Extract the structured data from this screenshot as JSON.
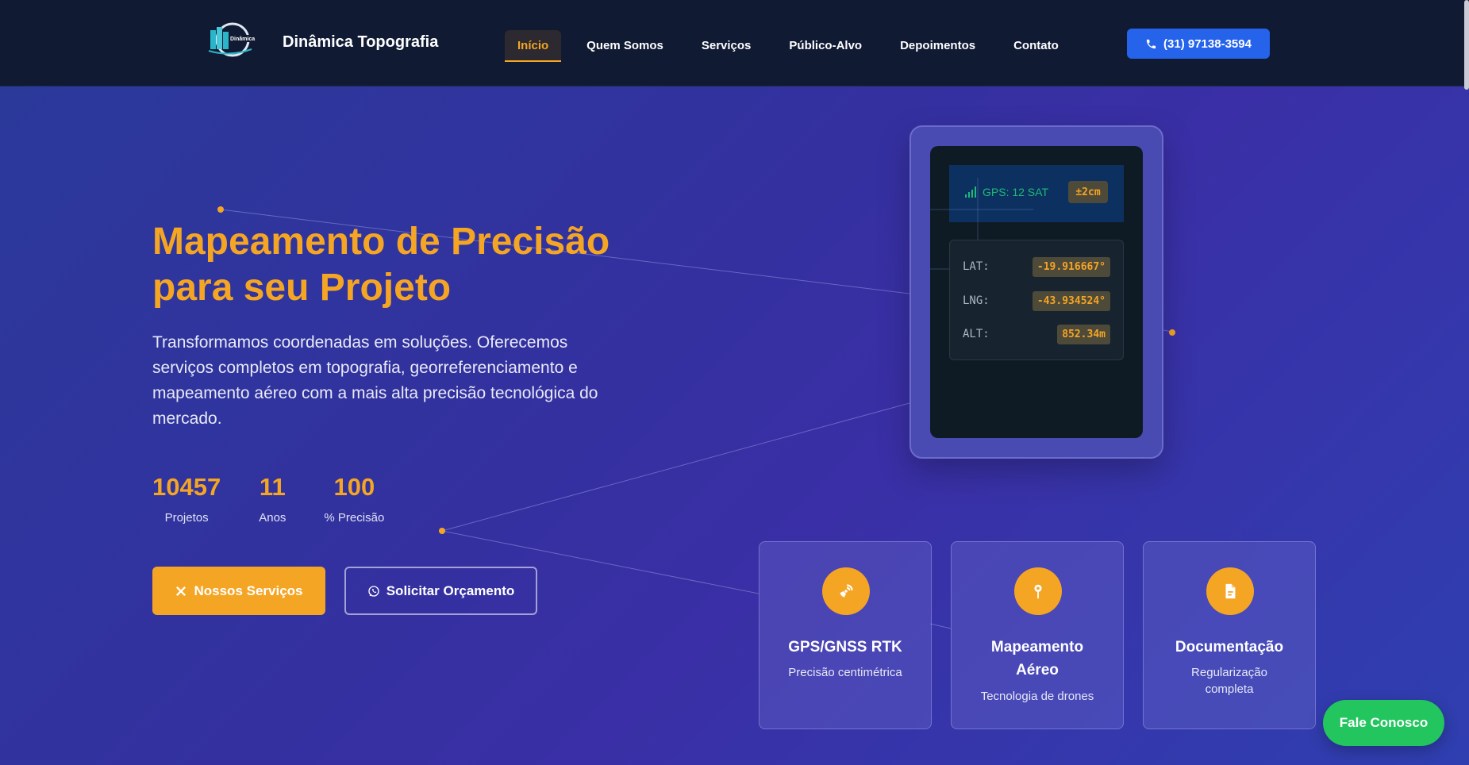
{
  "header": {
    "brand": "Dinâmica Topografia",
    "logo_text": "Dinâmica",
    "nav": [
      {
        "label": "Início",
        "active": true
      },
      {
        "label": "Quem Somos"
      },
      {
        "label": "Serviços"
      },
      {
        "label": "Público-Alvo"
      },
      {
        "label": "Depoimentos"
      },
      {
        "label": "Contato"
      }
    ],
    "phone": "(31) 97138-3594",
    "phone_icon": "phone-icon"
  },
  "hero": {
    "title": "Mapeamento de Precisão para seu Projeto",
    "description": "Transformamos coordenadas em soluções. Oferecemos serviços completos em topografia, georreferenciamento e mapeamento aéreo com a mais alta precisão tecnológica do mercado.",
    "stats": [
      {
        "value": "10457",
        "label": "Projetos"
      },
      {
        "value": "11",
        "label": "Anos"
      },
      {
        "value": "100",
        "label": "% Precisão"
      }
    ],
    "primary_button": "Nossos Serviços",
    "secondary_button": "Solicitar Orçamento"
  },
  "device": {
    "gps_status": "GPS: 12 SAT",
    "accuracy": "±2cm",
    "coords": [
      {
        "key": "LAT:",
        "value": "-19.916667°"
      },
      {
        "key": "LNG:",
        "value": "-43.934524°"
      },
      {
        "key": "ALT:",
        "value": "852.34m"
      }
    ]
  },
  "features": [
    {
      "title": "GPS/GNSS RTK",
      "subtitle": "Precisão centimétrica",
      "icon": "satellite-dish-icon"
    },
    {
      "title": "Mapeamento Aéreo",
      "subtitle": "Tecnologia de drones",
      "icon": "map-pin-icon"
    },
    {
      "title": "Documentação",
      "subtitle": "Regularização completa",
      "icon": "document-icon"
    }
  ],
  "fab_label": "Fale Conosco",
  "colors": {
    "accent": "#f5a524",
    "header_bg": "#101a33",
    "phone_button": "#2563eb",
    "fab": "#22c55e",
    "gps_green": "#1fb978"
  }
}
